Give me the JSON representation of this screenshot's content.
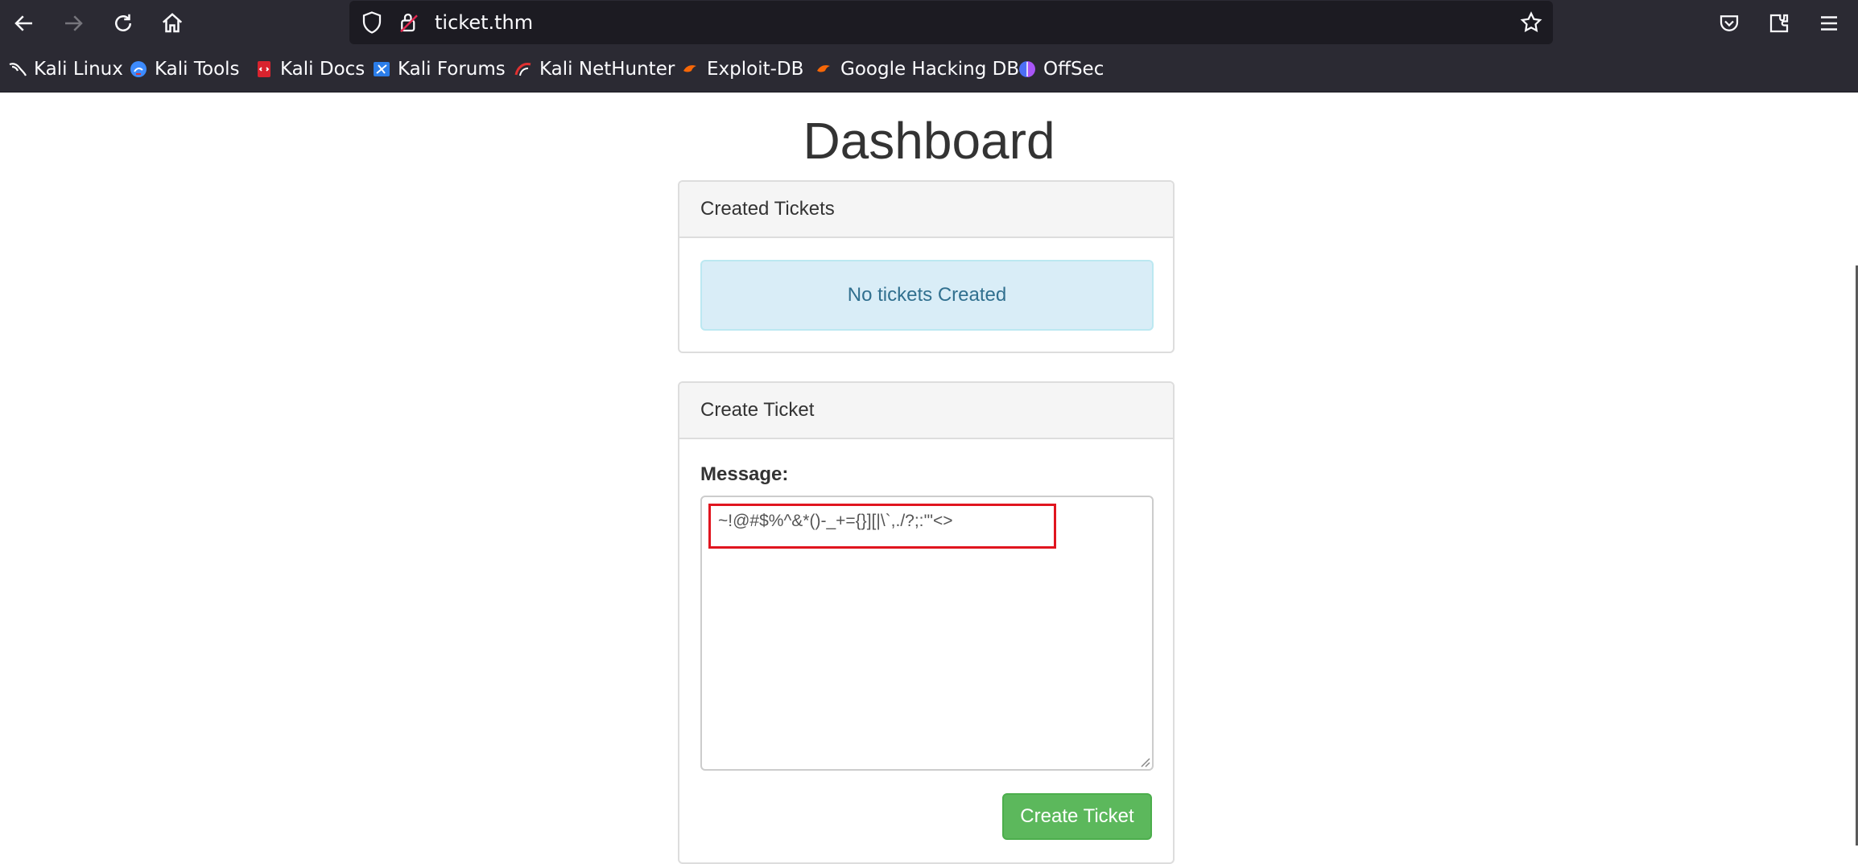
{
  "browser": {
    "url": "ticket.thm",
    "nav": {
      "back_icon": "arrow-left-icon",
      "forward_icon": "arrow-right-icon",
      "reload_icon": "reload-icon",
      "home_icon": "home-icon"
    },
    "right_icons": [
      "pocket-icon",
      "extensions-icon",
      "menu-icon"
    ],
    "bookmarks": [
      {
        "label": "Kali Linux",
        "icon": "kali-dragon-icon",
        "color": "#ffffff"
      },
      {
        "label": "Kali Tools",
        "icon": "kali-tools-icon",
        "color": "#3d8bfd"
      },
      {
        "label": "Kali Docs",
        "icon": "kali-docs-icon",
        "color": "#d9232e"
      },
      {
        "label": "Kali Forums",
        "icon": "kali-forums-icon",
        "color": "#2b7de9"
      },
      {
        "label": "Kali NetHunter",
        "icon": "nethunter-icon",
        "color": "#e03131"
      },
      {
        "label": "Exploit-DB",
        "icon": "exploit-db-icon",
        "color": "#f76707"
      },
      {
        "label": "Google Hacking DB",
        "icon": "ghdb-icon",
        "color": "#f76707"
      },
      {
        "label": "OffSec",
        "icon": "offsec-icon",
        "color": "#4c6ef5"
      }
    ]
  },
  "page": {
    "title": "Dashboard",
    "created_panel": {
      "heading": "Created Tickets",
      "empty_message": "No tickets Created"
    },
    "create_panel": {
      "heading": "Create Ticket",
      "message_label": "Message:",
      "message_value": "~!@#$%^&*()-_+={}][|\\`,./?;:'\"<>",
      "submit_label": "Create Ticket"
    }
  },
  "colors": {
    "success": "#5cb85c",
    "info_bg": "#d9edf7",
    "info_text": "#31708f",
    "highlight": "#e0151f"
  }
}
